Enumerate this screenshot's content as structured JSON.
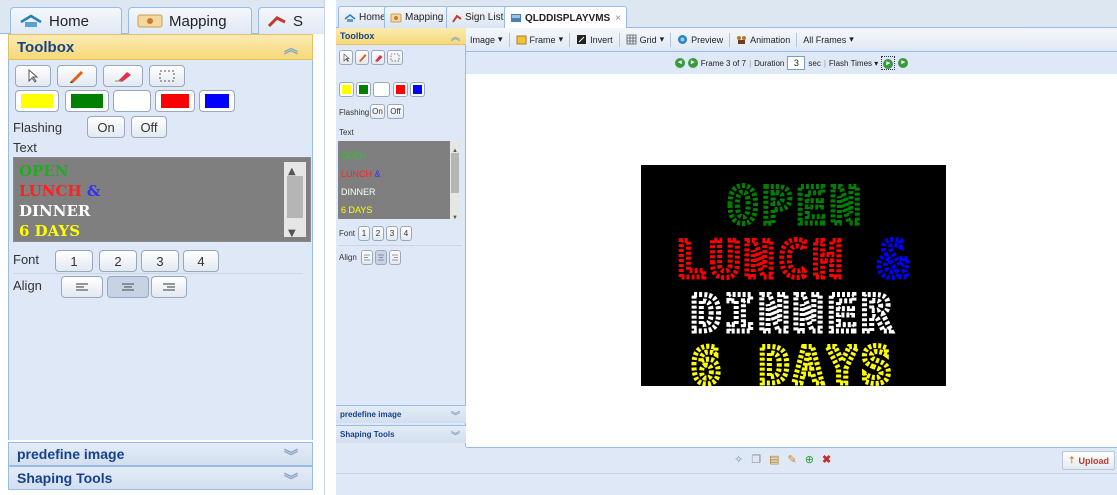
{
  "colors": {
    "accent_header": "#f7d977",
    "panel_bg": "#dfe8f6",
    "green": "#008000",
    "red": "#ff0000",
    "white": "#ffffff",
    "yellow": "#ffff00",
    "blue": "#0000ff",
    "sign_bg": "#000000"
  },
  "zoom_panel": {
    "tabs": [
      {
        "label": "Home",
        "icon": "home-icon"
      },
      {
        "label": "Mapping",
        "icon": "map-icon"
      },
      {
        "label": "S",
        "icon": "sign-icon"
      }
    ],
    "header": "Toolbox",
    "tools": [
      "pointer-icon",
      "pencil-icon",
      "eraser-icon",
      "select-icon"
    ],
    "swatches": [
      "#ffff00",
      "#008000",
      "#ffffff",
      "#ff0000",
      "#0000ff"
    ],
    "flashing_label": "Flashing",
    "on_label": "On",
    "off_label": "Off",
    "text_label": "Text",
    "text_lines": [
      {
        "text": "OPEN",
        "color": "#22aa22"
      },
      {
        "text": "LUNCH",
        "color": "#ff2020",
        "extra": " &",
        "extra_color": "#3030ff"
      },
      {
        "text": "DINNER",
        "color": "#ffffff"
      },
      {
        "text": "6 DAYS",
        "color": "#ffff00"
      }
    ],
    "font_label": "Font",
    "font_sizes": [
      "1",
      "2",
      "3",
      "4"
    ],
    "align_label": "Align",
    "align_options": [
      "align-left-icon",
      "align-center-icon",
      "align-right-icon"
    ],
    "predefine_label": "predefine image",
    "shaping_label": "Shaping Tools"
  },
  "app": {
    "tabs": [
      {
        "label": "Home",
        "icon": "home-icon"
      },
      {
        "label": "Mapping",
        "icon": "map-icon"
      },
      {
        "label": "Sign List",
        "icon": "sign-icon"
      },
      {
        "label": "QLDDISPLAYVMS",
        "icon": "display-icon",
        "close": "×"
      }
    ],
    "sidebar": {
      "header": "Toolbox",
      "flashing_label": "Flashing",
      "on_label": "On",
      "off_label": "Off",
      "text_label": "Text",
      "font_label": "Font",
      "font_sizes": [
        "1",
        "2",
        "3",
        "4"
      ],
      "align_label": "Align",
      "predefine_label": "predefine image",
      "shaping_label": "Shaping Tools"
    },
    "toolbar": {
      "image": "Image",
      "frame": "Frame",
      "invert": "Invert",
      "grid": "Grid",
      "preview": "Preview",
      "animation": "Animation",
      "all_frames": "All Frames"
    },
    "subbar": {
      "frame_text": "Frame 3 of 7",
      "duration_label": "Duration",
      "duration_value": "3",
      "sec_label": "sec",
      "flash_times": "Flash Times"
    },
    "sign_lines": [
      {
        "text": "OPEN",
        "color": "#008000"
      },
      {
        "text": "LUNCH",
        "color": "#ff0000"
      },
      {
        "text": "&",
        "color": "#0000ff"
      },
      {
        "text": "DINNER",
        "color": "#ffffff"
      },
      {
        "text": "6 DAYS",
        "color": "#ffff00"
      }
    ],
    "bottom": {
      "icons": [
        "pin-icon",
        "copy-icon",
        "paste-icon",
        "brush-icon",
        "add-icon",
        "delete-icon"
      ],
      "upload": "Upload"
    }
  }
}
